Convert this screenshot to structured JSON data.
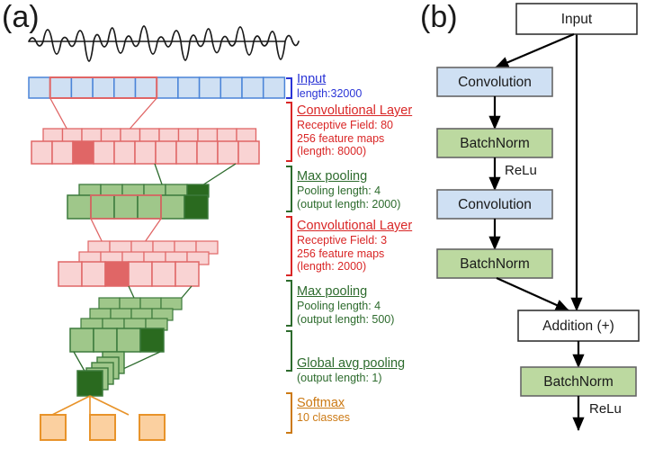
{
  "figure": {
    "panel_a_label": "(a)",
    "panel_b_label": "(b)"
  },
  "panel_a": {
    "waveform": {
      "name": "audio-waveform",
      "description": "raw audio signal"
    },
    "annotations": [
      {
        "id": "input",
        "title": "Input",
        "color": "#2b35d6",
        "lines": [
          "length:32000"
        ]
      },
      {
        "id": "conv1",
        "title": "Convolutional Layer",
        "color": "#d92626",
        "lines": [
          "Receptive Field: 80",
          "256 feature maps",
          "(length: 8000)"
        ]
      },
      {
        "id": "pool1",
        "title": "Max pooling",
        "color": "#2d6b2d",
        "lines": [
          "Pooling length: 4",
          "(output length: 2000)"
        ]
      },
      {
        "id": "conv2",
        "title": "Convolutional Layer",
        "color": "#d92626",
        "lines": [
          "Receptive Field: 3",
          "256 feature maps",
          "(length: 2000)"
        ]
      },
      {
        "id": "pool2",
        "title": "Max pooling",
        "color": "#2d6b2d",
        "lines": [
          "Pooling length: 4",
          "(output length: 500)"
        ]
      },
      {
        "id": "gap",
        "title": "Global avg pooling",
        "color": "#2d6b2d",
        "lines": [
          "(output length: 1)"
        ]
      },
      {
        "id": "softmax",
        "title": "Softmax",
        "color": "#cc7a15",
        "lines": [
          "10 classes"
        ]
      }
    ],
    "colors": {
      "input_fill": "#cfe0f3",
      "input_stroke": "#4a84d8",
      "conv_fill": "#f9d3d3",
      "conv_stroke": "#e06666",
      "conv_highlight": "#e06666",
      "pool_fill": "#9fc78a",
      "pool_stroke": "#3c7a3c",
      "pool_highlight": "#2a6a1f",
      "softmax_fill": "#fbd0a0",
      "softmax_stroke": "#e8932a"
    },
    "layer_cells": {
      "input_count": 12,
      "conv1_count": 12,
      "pool1_count": 7,
      "conv2_count": 7,
      "pool2_count": 5,
      "softmax_count": 3
    }
  },
  "panel_b": {
    "nodes": [
      {
        "id": "input",
        "label": "Input",
        "fill": "#ffffff"
      },
      {
        "id": "conv-1",
        "label": "Convolution",
        "fill": "#cfe0f3"
      },
      {
        "id": "bn-1",
        "label": "BatchNorm",
        "fill": "#bcd9a0"
      },
      {
        "id": "conv-2",
        "label": "Convolution",
        "fill": "#cfe0f3"
      },
      {
        "id": "bn-2",
        "label": "BatchNorm",
        "fill": "#bcd9a0"
      },
      {
        "id": "addition",
        "label": "Addition (+)",
        "fill": "#ffffff"
      },
      {
        "id": "bn-3",
        "label": "BatchNorm",
        "fill": "#bcd9a0"
      }
    ],
    "edge_labels": {
      "relu_1": "ReLu",
      "relu_2": "ReLu"
    },
    "colors": {
      "box_stroke": "#666666",
      "plain_stroke": "#333333",
      "arrow": "#000000"
    }
  }
}
